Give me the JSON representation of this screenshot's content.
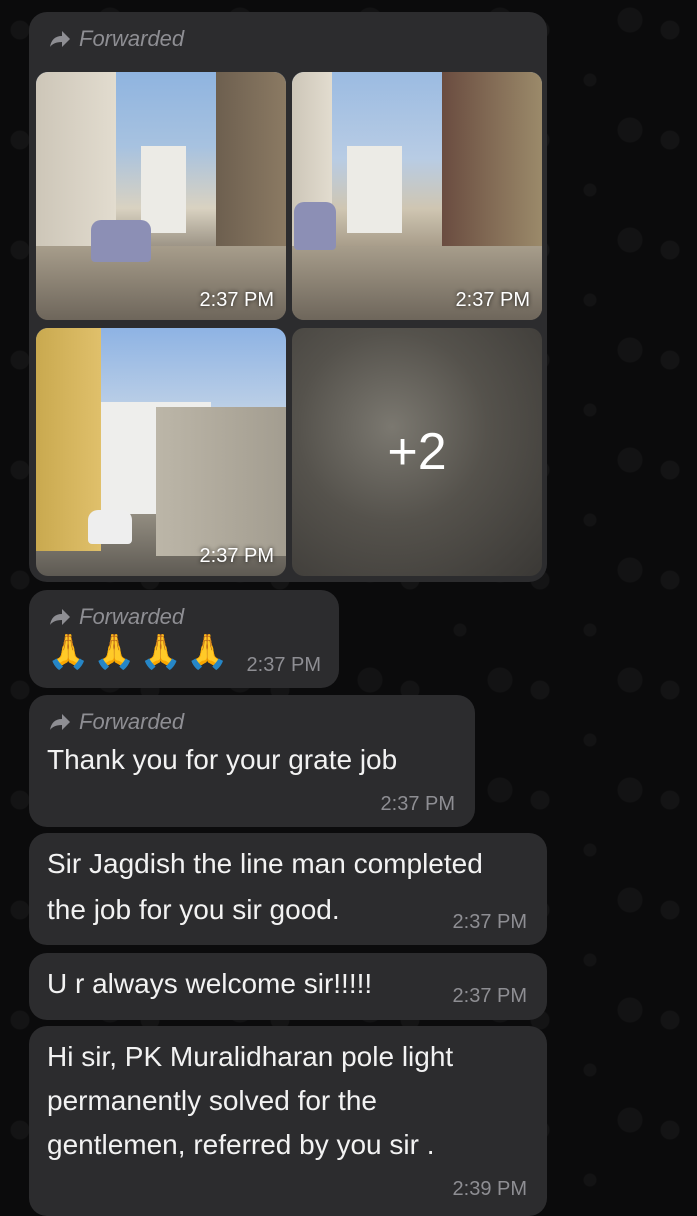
{
  "forwarded_label": "Forwarded",
  "media_message": {
    "photos": [
      {
        "timestamp": "2:37 PM"
      },
      {
        "timestamp": "2:37 PM"
      },
      {
        "timestamp": "2:37 PM"
      },
      {
        "timestamp": "",
        "more_count": "+2"
      }
    ]
  },
  "messages": [
    {
      "forwarded": true,
      "text": "🙏🙏🙏🙏",
      "time": "2:37 PM"
    },
    {
      "forwarded": true,
      "text": "Thank you for your grate job",
      "time": "2:37 PM"
    },
    {
      "forwarded": false,
      "lines": [
        "Sir Jagdish the line man completed",
        "the job for you sir good."
      ],
      "time": "2:37 PM"
    },
    {
      "forwarded": false,
      "text": "U r always welcome sir!!!!!",
      "time": "2:37 PM"
    },
    {
      "forwarded": false,
      "lines": [
        "Hi sir, PK Muralidharan pole light",
        "permanently solved for the",
        "gentlemen, referred by you sir ."
      ],
      "time": "2:39 PM"
    }
  ],
  "colors": {
    "background": "#0b0b0c",
    "bubble": "#2c2c2e",
    "meta_text": "#8e8e93"
  },
  "icons": {
    "forward": "forward-arrow-icon"
  }
}
